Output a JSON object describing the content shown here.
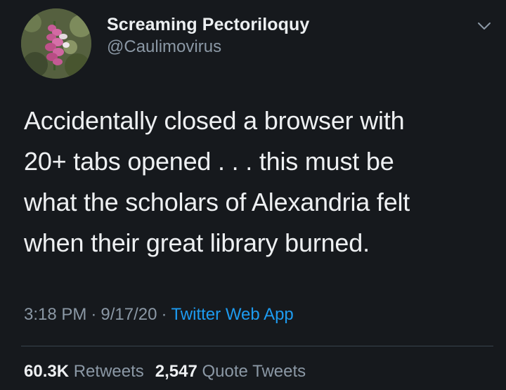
{
  "author": {
    "display_name": "Screaming Pectoriloquy",
    "handle": "@Caulimovirus",
    "avatar_icon": "foxglove-flower-avatar"
  },
  "menu": {
    "icon": "chevron-down-icon"
  },
  "tweet": {
    "text": "Accidentally closed a browser with\n20+ tabs opened . . . this must be\nwhat the scholars of Alexandria felt\nwhen their great library burned.",
    "time": "3:18 PM",
    "date": "9/17/20",
    "source": "Twitter Web App",
    "separator": "·"
  },
  "stats": {
    "retweets_count": "60.3K",
    "retweets_label": "Retweets",
    "quotes_count": "2,547",
    "quotes_label": "Quote Tweets"
  },
  "colors": {
    "background": "#16191d",
    "text": "#eef0f2",
    "muted": "#8b98a5",
    "link": "#1d9bf0",
    "divider": "#38444d"
  }
}
